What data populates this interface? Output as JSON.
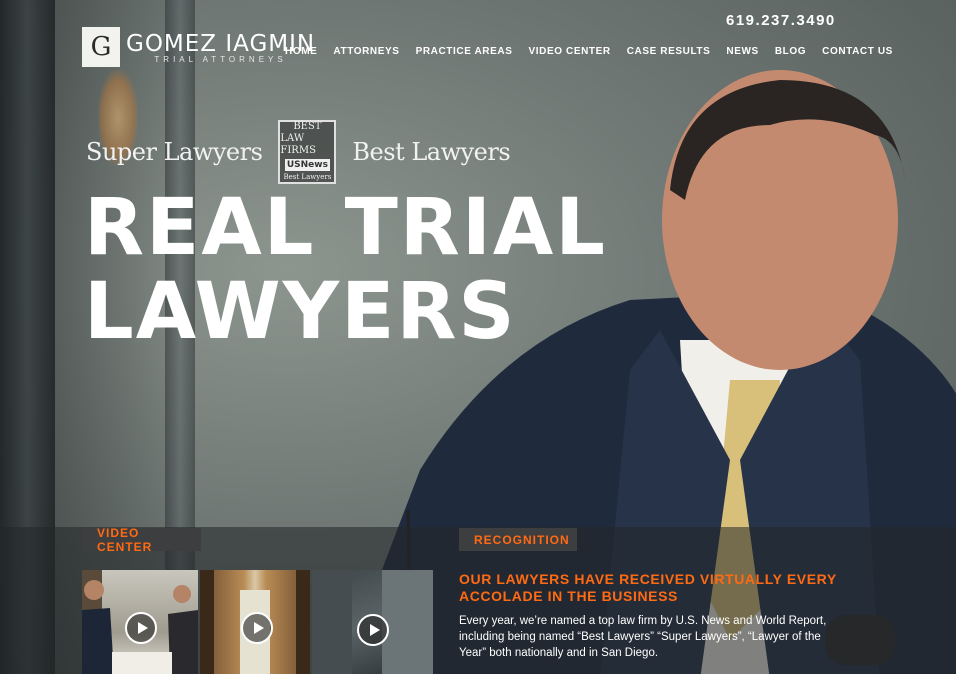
{
  "header": {
    "logo_mark": "G",
    "brand_name": "GOMEZ IAGMIN",
    "brand_tagline": "TRIAL ATTORNEYS",
    "phone": "619.237.3490",
    "nav": [
      {
        "label": "HOME"
      },
      {
        "label": "ATTORNEYS"
      },
      {
        "label": "PRACTICE AREAS"
      },
      {
        "label": "VIDEO CENTER"
      },
      {
        "label": "CASE RESULTS"
      },
      {
        "label": "NEWS"
      },
      {
        "label": "BLOG"
      },
      {
        "label": "CONTACT US"
      }
    ]
  },
  "awards": {
    "super_lawyers": "Super Lawyers",
    "badge_line1": "BEST",
    "badge_line2": "LAW FIRMS",
    "badge_line3": "USNews",
    "badge_line4": "Best Lawyers",
    "best_lawyers": "Best Lawyers"
  },
  "hero": {
    "headline_line1": "REAL TRIAL",
    "headline_line2": "LAWYERS"
  },
  "video_center": {
    "label": "VIDEO CENTER"
  },
  "recognition": {
    "label": "RECOGNITION",
    "title": "OUR LAWYERS HAVE RECEIVED VIRTUALLY EVERY ACCOLADE IN THE BUSINESS",
    "body": "Every year, we’re named a top law firm by U.S. News and World Report, including being named “Best Lawyers” “Super Lawyers”, “Lawyer of the Year” both nationally and in San Diego."
  },
  "colors": {
    "accent": "#ff6a13",
    "tab_bg": "#3d3e3f"
  }
}
